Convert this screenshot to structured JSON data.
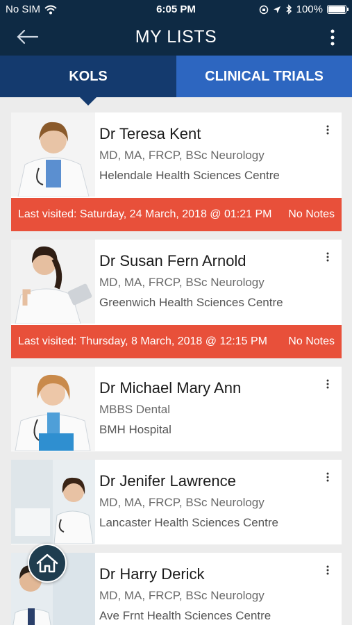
{
  "status_bar": {
    "carrier": "No SIM",
    "time": "6:05 PM",
    "battery": "100%"
  },
  "header": {
    "title": "MY LISTS",
    "back_icon": "arrow-left-icon",
    "menu_icon": "more-vertical-icon"
  },
  "tabs": [
    {
      "label": "KOLS",
      "active": true
    },
    {
      "label": "CLINICAL TRIALS",
      "active": false
    }
  ],
  "doctors": [
    {
      "name": "Dr Teresa Kent",
      "degrees": "MD, MA, FRCP, BSc Neurology",
      "institution": "Helendale Health Sciences Centre",
      "last_visited": "Last visited: Saturday, 24 March, 2018 @ 01:21 PM",
      "notes": "No Notes"
    },
    {
      "name": "Dr Susan Fern  Arnold",
      "degrees": "MD, MA, FRCP, BSc Neurology",
      "institution": "Greenwich Health Sciences Centre",
      "last_visited": "Last visited: Thursday, 8 March, 2018 @ 12:15 PM",
      "notes": "No Notes"
    },
    {
      "name": "Dr Michael  Mary Ann",
      "degrees": "MBBS Dental",
      "institution": "BMH Hospital"
    },
    {
      "name": "Dr Jenifer Lawrence",
      "degrees": "MD, MA, FRCP, BSc Neurology",
      "institution": "Lancaster Health Sciences Centre"
    },
    {
      "name": "Dr Harry Derick",
      "degrees": "MD, MA, FRCP, BSc Neurology",
      "institution": "Ave Frnt Health Sciences Centre"
    }
  ],
  "colors": {
    "header_bg": "#0e2a44",
    "tab_active": "#143a6e",
    "tab_inactive": "#2d66c0",
    "visit_banner": "#e8503a",
    "background": "#ececec"
  },
  "fab": {
    "icon": "home-icon"
  }
}
